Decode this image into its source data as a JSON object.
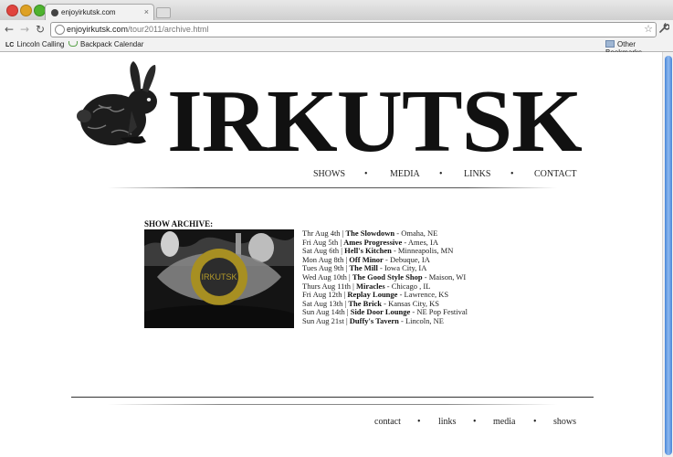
{
  "browser": {
    "tab_title": "enjoyirkutsk.com",
    "tab_close": "×",
    "url_domain": "enjoyirkutsk.com",
    "url_path": "/tour2011/archive.html",
    "back_glyph": "←",
    "forward_glyph": "→",
    "reload_glyph": "↻",
    "star_glyph": "☆",
    "wrench_glyph": "🔧",
    "bookmarks": [
      {
        "label": "Lincoln Calling",
        "icon": "LC"
      },
      {
        "label": "Backpack Calendar"
      }
    ],
    "other_bookmarks": "Other Bookmarks"
  },
  "site": {
    "logo_text": "IRKUTSK",
    "nav": [
      "SHOWS",
      "MEDIA",
      "LINKS",
      "CONTACT"
    ],
    "separator": "•",
    "archive_title": "SHOW ARCHIVE:",
    "photo_label": "IRKUTSK",
    "shows": [
      {
        "date": "Thr Aug 4th",
        "venue": "The Slowdown",
        "location": "Omaha, NE"
      },
      {
        "date": "Fri Aug 5th",
        "venue": "Ames Progressive",
        "location": "Ames, IA"
      },
      {
        "date": "Sat Aug 6th",
        "venue": "Hell's Kitchen",
        "location": "Minneapolis, MN"
      },
      {
        "date": "Mon Aug 8th",
        "venue": "Off Minor",
        "location": "Debuque, IA"
      },
      {
        "date": "Tues Aug 9th",
        "venue": "The Mill",
        "location": "Iowa City, IA"
      },
      {
        "date": "Wed Aug 10th",
        "venue": "The Good Style Shop",
        "location": "Maison, WI"
      },
      {
        "date": "Thurs Aug 11th",
        "venue": "Miracles",
        "location": "Chicago , IL"
      },
      {
        "date": "Fri Aug 12th",
        "venue": "Replay Lounge",
        "location": "Lawrence, KS"
      },
      {
        "date": "Sat Aug 13th",
        "venue": "The Brick",
        "location": "Kansas City, KS"
      },
      {
        "date": "Sun Aug 14th",
        "venue": "Side Door Lounge",
        "location": "NE Pop Festival"
      },
      {
        "date": "Sun Aug 21st",
        "venue": "Duffy's Tavern",
        "location": "Lincoln, NE"
      }
    ],
    "footer_nav": [
      "contact",
      "links",
      "media",
      "shows"
    ]
  },
  "colors": {
    "eye_ring": "#b39a2a",
    "scroll_thumb": "#4a86d8"
  }
}
